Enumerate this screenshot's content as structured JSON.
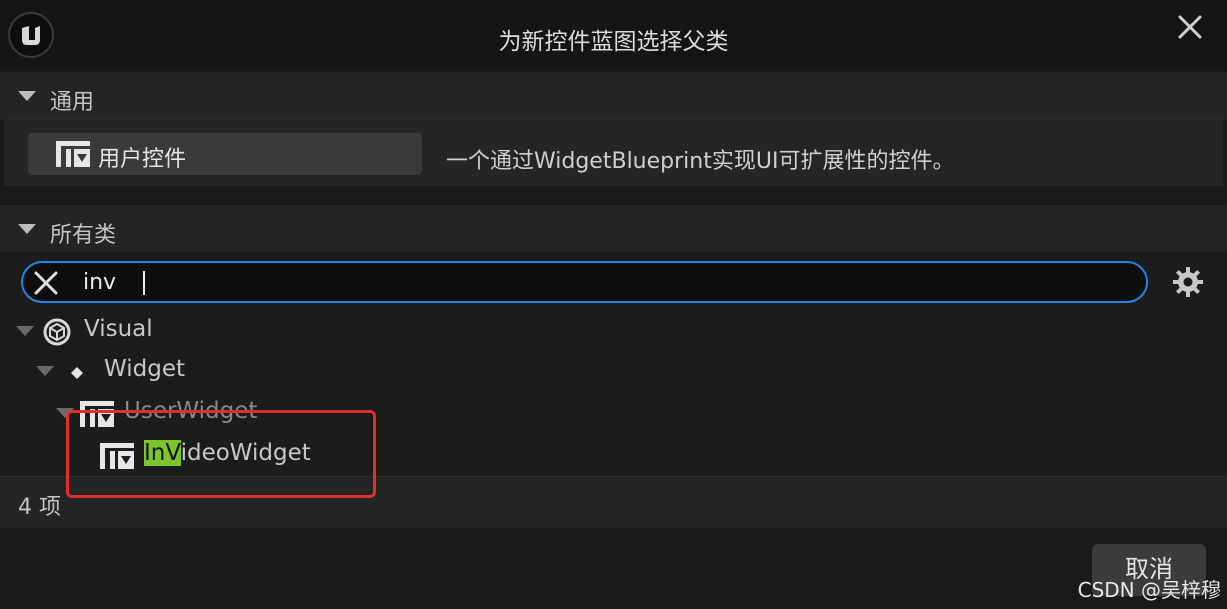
{
  "dialog": {
    "title": "为新控件蓝图选择父类"
  },
  "common_section": {
    "header": "通用",
    "user_widget_button": "用户控件",
    "description": "一个通过WidgetBlueprint实现UI可扩展性的控件。"
  },
  "all_classes_section": {
    "header": "所有类",
    "search_value": "inv"
  },
  "tree": {
    "visual": "Visual",
    "widget": "Widget",
    "user_widget": "UserWidget",
    "result_match": "InV",
    "result_rest": "ideoWidget"
  },
  "footer": {
    "count": "4 项"
  },
  "buttons": {
    "cancel": "取消"
  },
  "watermark": "CSDN @吴梓穆",
  "colors": {
    "accent": "#1e88e5",
    "highlight": "#7bc42a",
    "annotation": "#e0302a"
  }
}
